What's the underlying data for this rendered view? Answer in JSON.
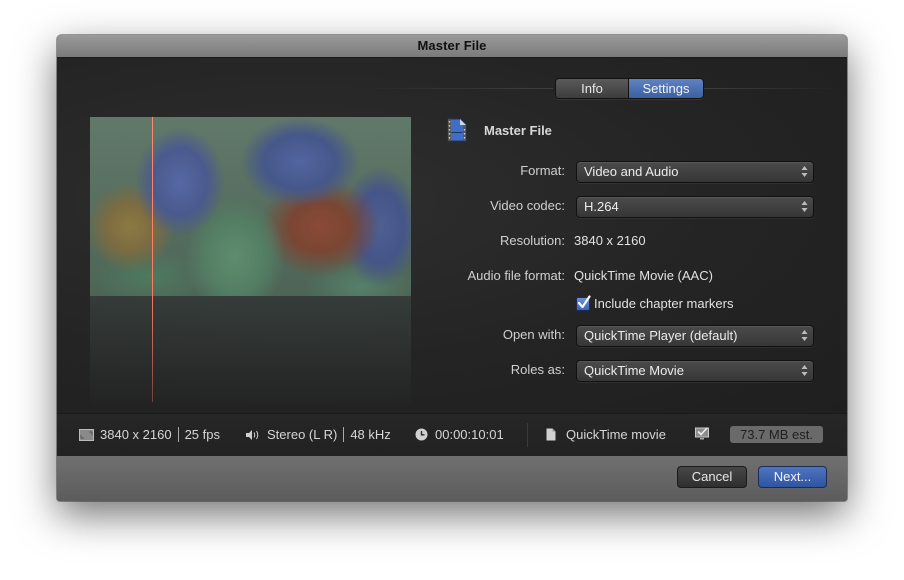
{
  "window": {
    "title": "Master File"
  },
  "tabs": [
    {
      "label": "Info",
      "selected": false
    },
    {
      "label": "Settings",
      "selected": true
    }
  ],
  "preview": {
    "description": "Rainbow lorikeets video frame thumbnail",
    "playhead_color": "#ff7a62"
  },
  "settings": {
    "file_title": "Master File",
    "file_icon": "film-document-icon",
    "format": {
      "label": "Format:",
      "value": "Video and Audio"
    },
    "video_codec": {
      "label": "Video codec:",
      "value": "H.264"
    },
    "resolution": {
      "label": "Resolution:",
      "value": "3840 x 2160"
    },
    "audio_file_format": {
      "label": "Audio file format:",
      "value": "QuickTime Movie (AAC)"
    },
    "chapter_markers": {
      "label": "Include chapter markers",
      "checked": true
    },
    "open_with": {
      "label": "Open with:",
      "value": "QuickTime Player (default)"
    },
    "roles_as": {
      "label": "Roles as:",
      "value": "QuickTime Movie"
    }
  },
  "status": {
    "resolution": "3840 x 2160",
    "fps": "25 fps",
    "audio_channels": "Stereo (L R)",
    "sample_rate": "48 kHz",
    "duration": "00:00:10:01",
    "file_type": "QuickTime movie",
    "size_estimate": "73.7 MB est."
  },
  "buttons": {
    "cancel": "Cancel",
    "next": "Next..."
  },
  "colors": {
    "accent": "#3c5f9f",
    "window_bg": "#262626"
  }
}
